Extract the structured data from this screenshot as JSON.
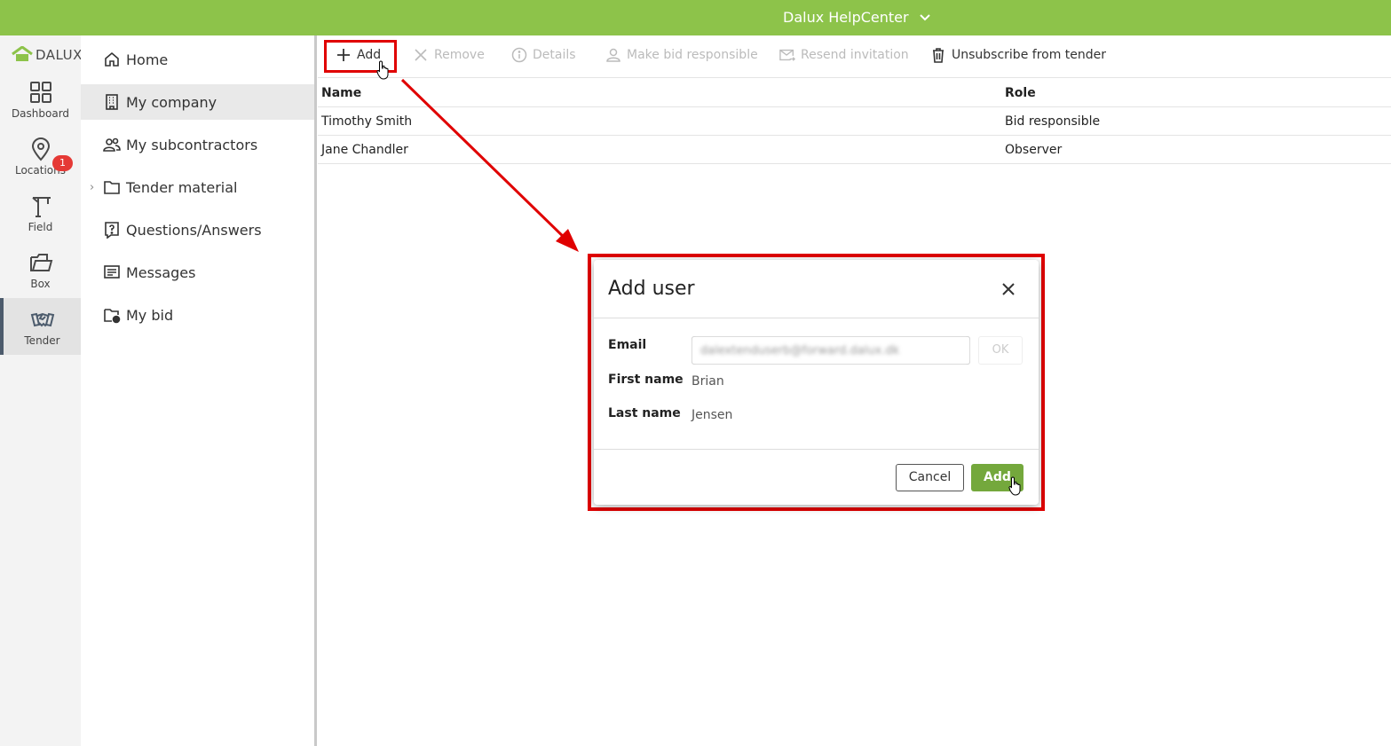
{
  "topbar": {
    "title": "Dalux HelpCenter"
  },
  "brand": {
    "logo_text": "DALUX",
    "accent": "#8dc34a",
    "highlight": "#e00000"
  },
  "rail": {
    "items": [
      {
        "label": "Dashboard",
        "icon": "dashboard-icon"
      },
      {
        "label": "Locations",
        "icon": "location-pin-icon"
      },
      {
        "label": "Field",
        "icon": "crane-icon",
        "badge": "1"
      },
      {
        "label": "Box",
        "icon": "folder-open-icon"
      },
      {
        "label": "Tender",
        "icon": "handshake-icon",
        "active": true
      }
    ]
  },
  "nav": {
    "items": [
      {
        "label": "Home",
        "icon": "home-icon"
      },
      {
        "label": "My company",
        "icon": "building-icon",
        "active": true
      },
      {
        "label": "My subcontractors",
        "icon": "users-icon"
      },
      {
        "label": "Tender material",
        "icon": "folder-icon",
        "expandable": true
      },
      {
        "label": "Questions/Answers",
        "icon": "question-icon"
      },
      {
        "label": "Messages",
        "icon": "messages-icon"
      },
      {
        "label": "My bid",
        "icon": "bid-folder-icon"
      }
    ]
  },
  "toolbar": {
    "add": "Add",
    "remove": "Remove",
    "details": "Details",
    "make_bid_responsible": "Make bid responsible",
    "resend_invitation": "Resend invitation",
    "unsubscribe": "Unsubscribe from tender"
  },
  "table": {
    "headers": {
      "name": "Name",
      "role": "Role"
    },
    "rows": [
      {
        "name": "Timothy Smith",
        "role": "Bid responsible"
      },
      {
        "name": "Jane Chandler",
        "role": "Observer"
      }
    ]
  },
  "dialog": {
    "title": "Add user",
    "email_label": "Email",
    "email_value": "dalextenduserb@forward.dalux.dk",
    "ok_label": "OK",
    "first_name_label": "First name",
    "first_name_value": "Brian",
    "last_name_label": "Last name",
    "last_name_value": "Jensen",
    "cancel_label": "Cancel",
    "add_label": "Add"
  }
}
